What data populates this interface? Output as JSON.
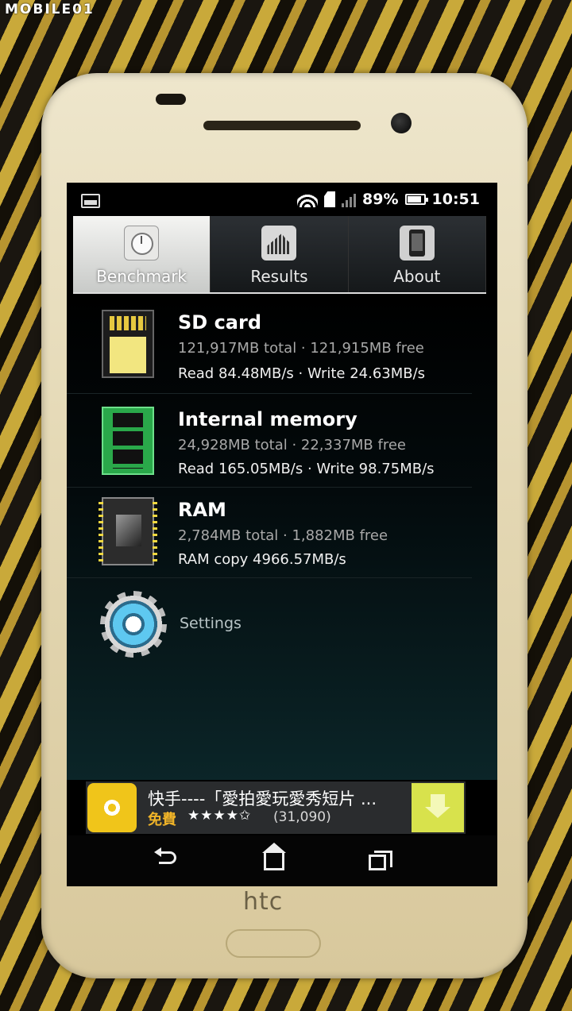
{
  "watermark": "MOBILE01",
  "status": {
    "battery": "89%",
    "time": "10:51"
  },
  "tabs": [
    {
      "label": "Benchmark",
      "icon": "clock-icon",
      "active": true
    },
    {
      "label": "Results",
      "icon": "bar-chart-icon",
      "active": false
    },
    {
      "label": "About",
      "icon": "phone-icon",
      "active": false
    }
  ],
  "items": {
    "sd": {
      "title": "SD card",
      "capacity": "121,917MB total · 121,915MB free",
      "speed": "Read 84.48MB/s · Write 24.63MB/s",
      "icon": "sd-card-icon"
    },
    "internal": {
      "title": "Internal memory",
      "capacity": "24,928MB total · 22,337MB free",
      "speed": "Read 165.05MB/s · Write 98.75MB/s",
      "icon": "memory-chip-icon"
    },
    "ram": {
      "title": "RAM",
      "capacity": "2,784MB total · 1,882MB free",
      "speed": "RAM copy 4966.57MB/s",
      "icon": "ram-chip-icon"
    },
    "settings": {
      "label": "Settings",
      "icon": "gear-icon"
    }
  },
  "ad": {
    "title": "快手----「愛拍愛玩愛秀短片 ...",
    "price": "免費",
    "stars": "★★★★✩",
    "rating_count": "(31,090)"
  },
  "device": {
    "brand": "htc"
  }
}
